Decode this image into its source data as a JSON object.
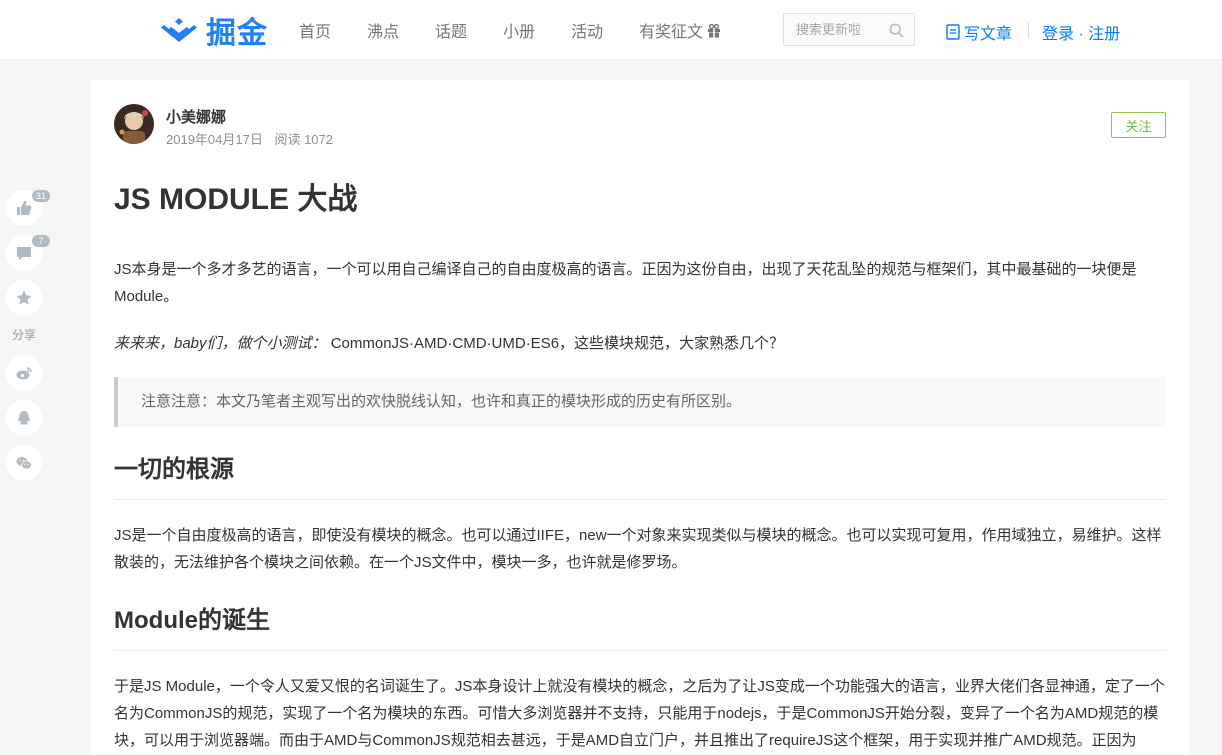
{
  "header": {
    "logo_text": "掘金",
    "nav": [
      "首页",
      "沸点",
      "话题",
      "小册",
      "活动",
      "有奖征文"
    ],
    "search_placeholder": "搜索更新啦",
    "write_label": "写文章",
    "login_label": "登录 · 注册"
  },
  "side": {
    "like_count": "31",
    "comment_count": "7",
    "share_label": "分享"
  },
  "article": {
    "author": "小美娜娜",
    "date": "2019年04月17日",
    "reads": "阅读 1072",
    "follow_label": "关注",
    "title": "JS MODULE 大战",
    "p1": "JS本身是一个多才多艺的语言，一个可以用自己编译自己的自由度极高的语言。正因为这份自由，出现了天花乱坠的规范与框架们，其中最基础的一块便是Module。",
    "p2_emph": "来来来，baby们，做个小测试：",
    "p2_rest": " CommonJS·AMD·CMD·UMD·ES6，这些模块规范，大家熟悉几个？",
    "note": "注意注意：本文乃笔者主观写出的欢快脱线认知，也许和真正的模块形成的历史有所区别。",
    "h1": "一切的根源",
    "p3": "JS是一个自由度极高的语言，即使没有模块的概念。也可以通过IIFE，new一个对象来实现类似与模块的概念。也可以实现可复用，作用域独立，易维护。这样散装的，无法维护各个模块之间依赖。在一个JS文件中，模块一多，也许就是修罗场。",
    "h2": "Module的诞生",
    "p4": "于是JS Module，一个令人又爱又恨的名词诞生了。JS本身设计上就没有模块的概念，之后为了让JS变成一个功能强大的语言，业界大佬们各显神通，定了一个名为CommonJS的规范，实现了一个名为模块的东西。可惜大多浏览器并不支持，只能用于nodejs，于是CommonJS开始分裂，变异了一个名为AMD规范的模块，可以用于浏览器端。而由于AMD与CommonJS规范相去甚远，于是AMD自立门户，并且推出了requireJS这个框架，用于实现并推广AMD规范。正因为"
  },
  "colors": {
    "brand": "#1e80ff",
    "link": "#007fff",
    "follow": "#6cbd45"
  }
}
